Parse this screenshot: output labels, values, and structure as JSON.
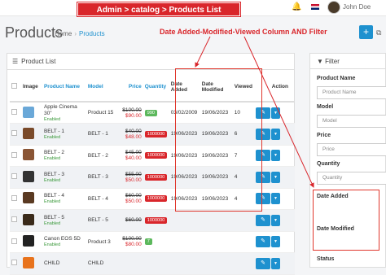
{
  "header": {
    "banner": "Admin > catalog > Products List",
    "user_name": "John Doe"
  },
  "page": {
    "title": "Products",
    "breadcrumb": [
      "Home",
      "Products"
    ],
    "annotation": "Date Added-Modified-Viewed Column AND Filter"
  },
  "list": {
    "heading": "Product List",
    "columns": [
      "Image",
      "Product Name",
      "Model",
      "Price",
      "Quantity",
      "Date Added",
      "Date Modified",
      "Viewed",
      "Action"
    ],
    "rows": [
      {
        "name": "Apple Cinema 30\"",
        "status": "Enabled",
        "model": "Product 15",
        "price_old": "$100.00",
        "price_new": "$90.00",
        "qty": "990",
        "qty_color": "#5cb85c",
        "added": "03/02/2009",
        "modified": "19/06/2023",
        "viewed": "10",
        "thumb": "#6aa8d8"
      },
      {
        "name": "BELT - 1",
        "status": "Enabled",
        "model": "BELT - 1",
        "price_old": "$40.00",
        "price_new": "$48.00",
        "qty": "1000000",
        "qty_color": "#d9262b",
        "added": "19/06/2023",
        "modified": "19/06/2023",
        "viewed": "6",
        "thumb": "#7a4a2a"
      },
      {
        "name": "BELT - 2",
        "status": "Enabled",
        "model": "BELT - 2",
        "price_old": "$45.00",
        "price_new": "$40.00",
        "qty": "1000000",
        "qty_color": "#d9262b",
        "added": "19/06/2023",
        "modified": "19/06/2023",
        "viewed": "7",
        "thumb": "#8a5535"
      },
      {
        "name": "BELT - 3",
        "status": "Enabled",
        "model": "BELT - 3",
        "price_old": "$55.00",
        "price_new": "$50.00",
        "qty": "1000000",
        "qty_color": "#d9262b",
        "added": "19/06/2023",
        "modified": "19/06/2023",
        "viewed": "4",
        "thumb": "#333333"
      },
      {
        "name": "BELT - 4",
        "status": "Enabled",
        "model": "BELT - 4",
        "price_old": "$60.00",
        "price_new": "$50.00",
        "qty": "1000000",
        "qty_color": "#d9262b",
        "added": "19/06/2023",
        "modified": "19/06/2023",
        "viewed": "4",
        "thumb": "#5a3a22"
      },
      {
        "name": "BELT - 5",
        "status": "Enabled",
        "model": "BELT - 5",
        "price_old": "$60.00",
        "price_new": "",
        "qty": "1000000",
        "qty_color": "#d9262b",
        "added": "",
        "modified": "",
        "viewed": "",
        "thumb": "#3a2a1a"
      },
      {
        "name": "Canon EOS 5D",
        "status": "Enabled",
        "model": "Product 3",
        "price_old": "$100.00",
        "price_new": "$80.00",
        "qty": "7",
        "qty_color": "#5cb85c",
        "added": "",
        "modified": "",
        "viewed": "",
        "thumb": "#222222"
      },
      {
        "name": "CHILD",
        "status": "",
        "model": "CHILD",
        "price_old": "",
        "price_new": "",
        "qty": "",
        "qty_color": "#d9262b",
        "added": "",
        "modified": "",
        "viewed": "",
        "thumb": "#e8731c"
      }
    ]
  },
  "filter": {
    "heading": "Filter",
    "fields": [
      {
        "label": "Product Name",
        "placeholder": "Product Name"
      },
      {
        "label": "Model",
        "placeholder": "Model"
      },
      {
        "label": "Price",
        "placeholder": "Price"
      },
      {
        "label": "Quantity",
        "placeholder": "Quantity"
      }
    ],
    "date_added": "Date Added",
    "date_modified": "Date Modified",
    "status": "Status"
  }
}
